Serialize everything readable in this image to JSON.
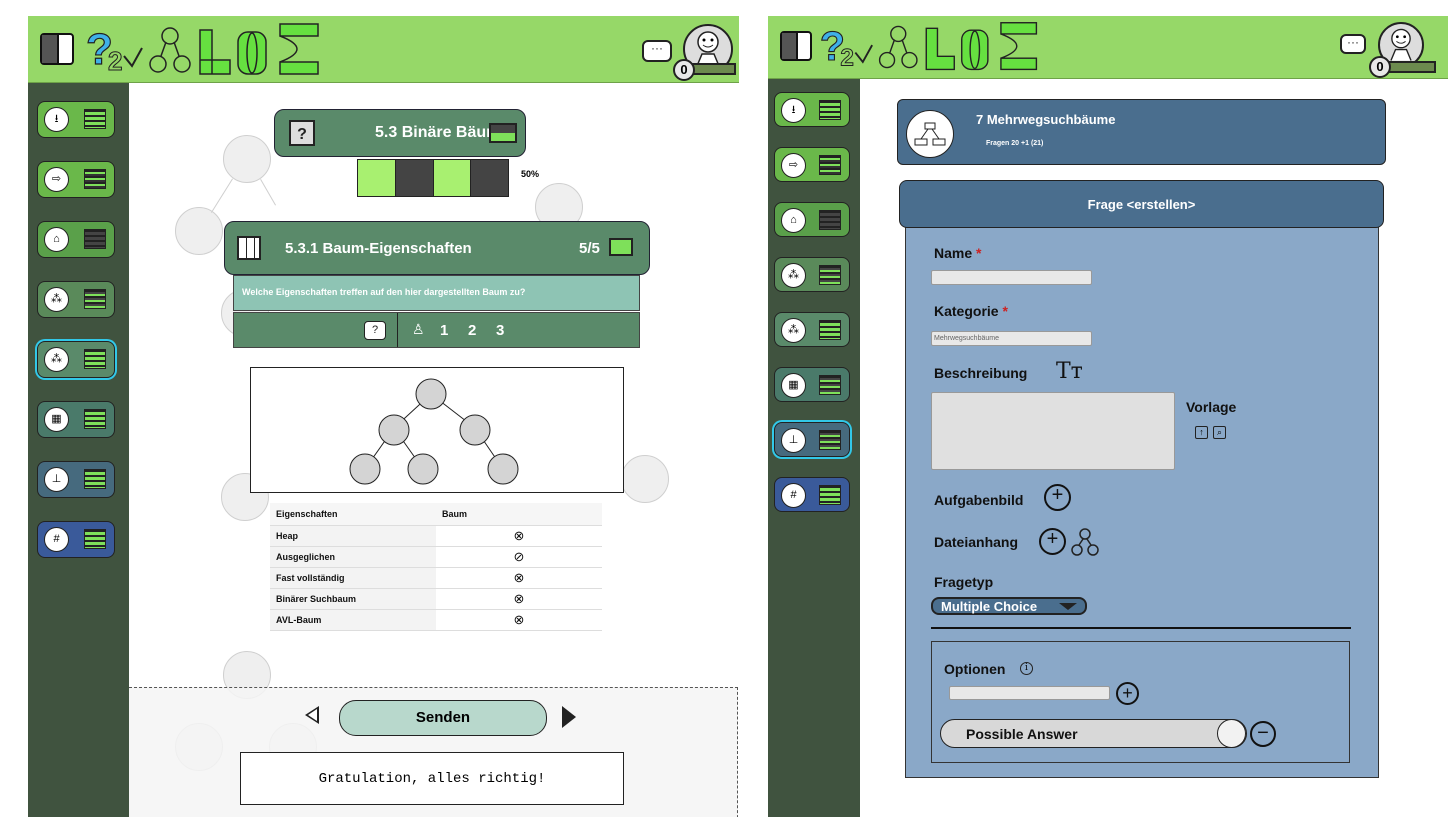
{
  "left": {
    "card_main": {
      "title": "5.3 Binäre Bäume",
      "progress": "50%"
    },
    "card_sub": {
      "title": "5.3.1 Baum-Eigenschaften",
      "score": "5/5",
      "question": "Welche Eigenschaften treffen auf den hier dargestellten Baum zu?",
      "levels": [
        "1",
        "2",
        "3"
      ]
    },
    "table": {
      "headers": [
        "Eigenschaften",
        "Baum"
      ],
      "rows": [
        {
          "name": "Heap",
          "mark": "⊗"
        },
        {
          "name": "Ausgeglichen",
          "mark": "⊘"
        },
        {
          "name": "Fast vollständig",
          "mark": "⊗"
        },
        {
          "name": "Binärer Suchbaum",
          "mark": "⊗"
        },
        {
          "name": "AVL-Baum",
          "mark": "⊗"
        }
      ]
    },
    "send_label": "Senden",
    "feedback": "Gratulation, alles richtig!",
    "badge_count": "0"
  },
  "right": {
    "course": {
      "title": "7 Mehrwegsuchbäume",
      "subtitle": "Fragen 20 +1 (21)"
    },
    "form": {
      "header": "Frage <erstellen>",
      "name_label": "Name",
      "category_label": "Kategorie",
      "category_value": "Mehrwegsuchbäume",
      "description_label": "Beschreibung",
      "template_label": "Vorlage",
      "image_label": "Aufgabenbild",
      "attachment_label": "Dateianhang",
      "type_label": "Fragetyp",
      "type_value": "Multiple Choice",
      "options_label": "Optionen",
      "answer_placeholder": "Possible Answer",
      "required_mark": "*",
      "text_format_icon": "Tт"
    },
    "badge_count": "0"
  },
  "colors": {
    "topbar": "#96d868",
    "sidebar": "#40533f",
    "card_green": "#5a8a6a",
    "card_blue": "#4a6e8e",
    "form_bg": "#8aa8c8",
    "selected": "#32c8e8"
  }
}
